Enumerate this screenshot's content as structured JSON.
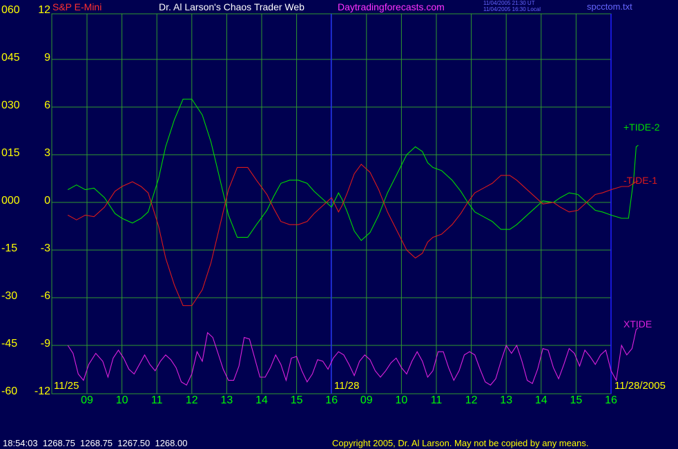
{
  "header": {
    "instrument": "S&P E-Mini",
    "title": "Dr. Al Larson's Chaos Trader Web",
    "site": "Daytradingforecasts.com",
    "stamp_line1": "11/04/2005 21:30 UT",
    "stamp_line2": "11/04/2005 16:30 Local",
    "filename": "spcctom.txt"
  },
  "footer": {
    "quote": "18:54:03  1268.75  1268.75  1267.50  1268.00",
    "copyright": "Copyright 2005, Dr. Al Larson. May not be copied by any means."
  },
  "colors": {
    "background": "#000050",
    "grid": "#2f9a2f",
    "yellow_text": "#ffff00",
    "green_text": "#00ff00",
    "tide2": "#00dd00",
    "tide1": "#dd1a1a",
    "xtide": "#dd22dd",
    "title_text": "#ffffff",
    "instrument_text": "#ff3030",
    "site_text": "#ff33ff",
    "stamp_text": "#6666ff",
    "date_marker": "#2020ff"
  },
  "chart_data": {
    "type": "line",
    "x_ticks": [
      "09",
      "10",
      "11",
      "12",
      "13",
      "14",
      "15",
      "16",
      "09",
      "10",
      "11",
      "12",
      "13",
      "14",
      "15",
      "16"
    ],
    "date_labels": [
      "11/25",
      "11/28",
      "11/28/2005"
    ],
    "xlim": [
      0,
      16
    ],
    "y_left_outer_ticks": [
      "060",
      "045",
      "030",
      "015",
      "000",
      "-15",
      "-30",
      "-45",
      "-60"
    ],
    "y_left_inner_ticks": [
      "12",
      "9",
      "6",
      "3",
      "0",
      "-3",
      "-6",
      "-9",
      "-12"
    ],
    "ylim": [
      -12,
      12
    ],
    "grid": true,
    "legend_placement": "right",
    "series": [
      {
        "name": "+TIDE-2",
        "color": "#00dd00",
        "x": [
          -0.55,
          -0.3,
          -0.05,
          0.2,
          0.5,
          0.8,
          1.0,
          1.3,
          1.55,
          1.75,
          2.05,
          2.25,
          2.5,
          2.75,
          3.0,
          3.3,
          3.55,
          3.8,
          4.05,
          4.3,
          4.6,
          4.85,
          5.15,
          5.35,
          5.55,
          5.8,
          6.05,
          6.3,
          6.5,
          6.75,
          7.0,
          7.2,
          7.3,
          7.45,
          7.65,
          7.85,
          8.1,
          8.35,
          8.6,
          8.9,
          9.15,
          9.4,
          9.6,
          9.75,
          9.9,
          10.15,
          10.45,
          10.7,
          10.9,
          11.1,
          11.35,
          11.6,
          11.85,
          12.1,
          12.3,
          12.55,
          12.8,
          13.05,
          13.35,
          13.55,
          13.8,
          14.05,
          14.3,
          14.55,
          14.75,
          15.0,
          15.3,
          15.5,
          15.65,
          15.72,
          15.78
        ],
        "y": [
          0.8,
          1.1,
          0.8,
          0.9,
          0.3,
          -0.7,
          -1.0,
          -1.3,
          -1.0,
          -0.6,
          1.5,
          3.5,
          5.2,
          6.5,
          6.5,
          5.5,
          3.8,
          1.5,
          -0.8,
          -2.2,
          -2.2,
          -1.4,
          -0.5,
          0.4,
          1.2,
          1.4,
          1.4,
          1.2,
          0.7,
          0.2,
          -0.3,
          0.6,
          0.2,
          -0.6,
          -1.8,
          -2.4,
          -1.9,
          -0.8,
          0.6,
          1.9,
          3.0,
          3.5,
          3.2,
          2.5,
          2.2,
          2.0,
          1.4,
          0.7,
          0.0,
          -0.6,
          -0.9,
          -1.2,
          -1.7,
          -1.7,
          -1.4,
          -0.9,
          -0.4,
          0.1,
          0.0,
          0.3,
          0.6,
          0.5,
          0.0,
          -0.5,
          -0.6,
          -0.8,
          -1.0,
          -1.0,
          1.5,
          3.5,
          3.6
        ]
      },
      {
        "name": "-TIDE-1",
        "color": "#dd1a1a",
        "x": [
          -0.55,
          -0.3,
          -0.05,
          0.2,
          0.5,
          0.8,
          1.0,
          1.3,
          1.55,
          1.75,
          2.05,
          2.25,
          2.5,
          2.75,
          3.0,
          3.3,
          3.55,
          3.8,
          4.05,
          4.3,
          4.6,
          4.85,
          5.15,
          5.35,
          5.55,
          5.8,
          6.05,
          6.3,
          6.5,
          6.75,
          7.0,
          7.2,
          7.3,
          7.45,
          7.65,
          7.85,
          8.1,
          8.35,
          8.6,
          8.9,
          9.15,
          9.4,
          9.6,
          9.75,
          9.9,
          10.15,
          10.45,
          10.7,
          10.9,
          11.1,
          11.35,
          11.6,
          11.85,
          12.1,
          12.3,
          12.55,
          12.8,
          13.05,
          13.35,
          13.55,
          13.8,
          14.05,
          14.3,
          14.55,
          14.75,
          15.0,
          15.3,
          15.5,
          15.65,
          15.72,
          15.78
        ],
        "y": [
          -0.8,
          -1.1,
          -0.8,
          -0.9,
          -0.3,
          0.7,
          1.0,
          1.3,
          1.0,
          0.6,
          -1.5,
          -3.5,
          -5.2,
          -6.5,
          -6.5,
          -5.5,
          -3.8,
          -1.5,
          0.8,
          2.2,
          2.2,
          1.4,
          0.5,
          -0.4,
          -1.2,
          -1.4,
          -1.4,
          -1.2,
          -0.7,
          -0.2,
          0.3,
          -0.6,
          -0.2,
          0.6,
          1.8,
          2.4,
          1.9,
          0.8,
          -0.6,
          -1.9,
          -3.0,
          -3.5,
          -3.2,
          -2.5,
          -2.2,
          -2.0,
          -1.4,
          -0.7,
          0.0,
          0.6,
          0.9,
          1.2,
          1.7,
          1.7,
          1.4,
          0.9,
          0.4,
          -0.1,
          0.0,
          -0.3,
          -0.6,
          -0.5,
          0.0,
          0.5,
          0.6,
          0.8,
          1.0,
          1.0,
          1.2,
          1.3,
          1.35
        ]
      },
      {
        "name": "XTIDE",
        "color": "#dd22dd",
        "x": [
          -0.55,
          -0.4,
          -0.25,
          -0.1,
          0.05,
          0.25,
          0.45,
          0.6,
          0.75,
          0.9,
          1.05,
          1.2,
          1.35,
          1.5,
          1.65,
          1.8,
          1.95,
          2.1,
          2.25,
          2.4,
          2.55,
          2.7,
          2.85,
          3.0,
          3.15,
          3.3,
          3.45,
          3.6,
          3.75,
          3.9,
          4.05,
          4.2,
          4.35,
          4.5,
          4.65,
          4.8,
          4.95,
          5.1,
          5.25,
          5.4,
          5.55,
          5.7,
          5.85,
          6.0,
          6.15,
          6.3,
          6.45,
          6.6,
          6.75,
          6.9,
          7.05,
          7.2,
          7.35,
          7.5,
          7.65,
          7.8,
          7.95,
          8.1,
          8.25,
          8.4,
          8.55,
          8.7,
          8.85,
          9.0,
          9.15,
          9.3,
          9.45,
          9.6,
          9.75,
          9.9,
          10.05,
          10.2,
          10.35,
          10.5,
          10.65,
          10.8,
          10.95,
          11.1,
          11.25,
          11.4,
          11.55,
          11.7,
          11.85,
          12.0,
          12.15,
          12.3,
          12.45,
          12.6,
          12.75,
          12.9,
          13.05,
          13.2,
          13.35,
          13.5,
          13.65,
          13.8,
          13.95,
          14.1,
          14.25,
          14.4,
          14.55,
          14.7,
          14.85,
          15.0,
          15.15,
          15.3,
          15.45,
          15.6,
          15.72,
          15.78
        ],
        "y": [
          -9.0,
          -9.5,
          -10.8,
          -11.2,
          -10.2,
          -9.5,
          -10.0,
          -11.0,
          -9.8,
          -9.3,
          -9.8,
          -10.5,
          -10.8,
          -10.2,
          -9.6,
          -10.2,
          -10.6,
          -10.0,
          -9.6,
          -9.9,
          -10.4,
          -11.3,
          -11.5,
          -10.8,
          -9.4,
          -10.0,
          -8.2,
          -8.5,
          -9.5,
          -10.5,
          -11.2,
          -11.2,
          -10.3,
          -8.5,
          -8.6,
          -9.8,
          -11.0,
          -11.0,
          -10.4,
          -9.6,
          -10.2,
          -11.2,
          -9.8,
          -9.7,
          -10.6,
          -11.3,
          -10.8,
          -9.9,
          -10.0,
          -10.5,
          -9.8,
          -9.4,
          -9.6,
          -10.2,
          -10.9,
          -10.0,
          -9.6,
          -9.9,
          -10.6,
          -11.0,
          -10.6,
          -10.1,
          -9.8,
          -10.4,
          -10.8,
          -10.0,
          -9.4,
          -10.0,
          -11.0,
          -10.6,
          -9.4,
          -9.4,
          -10.4,
          -11.2,
          -10.6,
          -9.6,
          -9.4,
          -9.6,
          -10.5,
          -11.3,
          -11.5,
          -11.1,
          -10.0,
          -9.0,
          -9.5,
          -9.0,
          -10.0,
          -11.2,
          -11.4,
          -10.5,
          -9.2,
          -9.3,
          -10.4,
          -11.1,
          -10.2,
          -9.2,
          -9.5,
          -10.3,
          -9.3,
          -9.7,
          -10.2,
          -9.6,
          -9.3,
          -10.6,
          -11.2,
          -9.0,
          -9.6,
          -9.2,
          -8.0,
          -7.9
        ]
      }
    ]
  }
}
